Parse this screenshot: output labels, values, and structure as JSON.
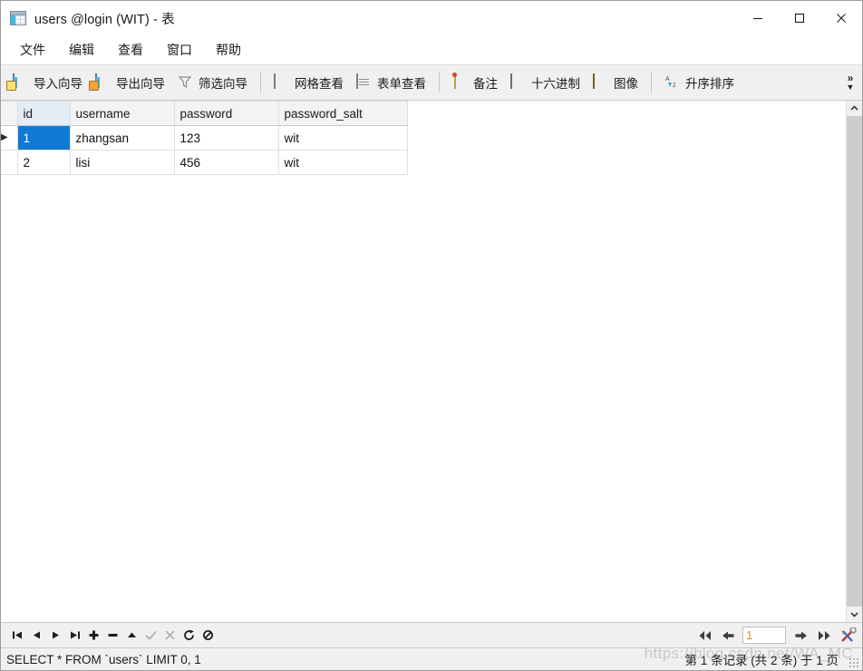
{
  "window": {
    "title": "users @login (WIT) - 表",
    "app_icon": "table-window-icon",
    "controls": {
      "minimize": "minimize-icon",
      "maximize": "maximize-icon",
      "close": "close-icon"
    }
  },
  "menubar": {
    "items": [
      {
        "label": "文件"
      },
      {
        "label": "编辑"
      },
      {
        "label": "查看"
      },
      {
        "label": "窗口"
      },
      {
        "label": "帮助"
      }
    ]
  },
  "toolbar": {
    "groups": [
      {
        "buttons": [
          {
            "label": "导入向导",
            "icon": "import-wizard-icon"
          },
          {
            "label": "导出向导",
            "icon": "export-wizard-icon"
          },
          {
            "label": "筛选向导",
            "icon": "filter-funnel-icon"
          }
        ]
      },
      {
        "buttons": [
          {
            "label": "网格查看",
            "icon": "grid-view-icon"
          },
          {
            "label": "表单查看",
            "icon": "form-view-icon"
          }
        ]
      },
      {
        "buttons": [
          {
            "label": "备注",
            "icon": "note-icon"
          },
          {
            "label": "十六进制",
            "icon": "hex-icon"
          },
          {
            "label": "图像",
            "icon": "image-icon"
          }
        ]
      },
      {
        "buttons": [
          {
            "label": "升序排序",
            "icon": "sort-ascending-icon"
          }
        ]
      }
    ],
    "overflow": {
      "chevron": "»",
      "dropdown": "▼"
    }
  },
  "grid": {
    "columns": [
      {
        "key": "id",
        "label": "id",
        "align": "right",
        "selected": true
      },
      {
        "key": "username",
        "label": "username",
        "align": "left",
        "selected": false
      },
      {
        "key": "password",
        "label": "password",
        "align": "left",
        "selected": false
      },
      {
        "key": "password_salt",
        "label": "password_salt",
        "align": "left",
        "selected": false
      }
    ],
    "rows": [
      {
        "marker": "▶",
        "current": true,
        "cells": {
          "id": "1",
          "username": "zhangsan",
          "password": "123",
          "password_salt": "wit"
        }
      },
      {
        "marker": "",
        "current": false,
        "cells": {
          "id": "2",
          "username": "lisi",
          "password": "456",
          "password_salt": "wit"
        }
      }
    ]
  },
  "scrollbar": {
    "up_icon": "chevron-up-icon",
    "down_icon": "chevron-down-icon"
  },
  "navbar": {
    "buttons": [
      {
        "name": "first-record",
        "icon": "skip-to-start-icon",
        "disabled": false
      },
      {
        "name": "previous-record",
        "icon": "play-back-icon",
        "disabled": false
      },
      {
        "name": "next-record",
        "icon": "play-forward-icon",
        "disabled": false
      },
      {
        "name": "last-record",
        "icon": "skip-to-end-icon",
        "disabled": false
      },
      {
        "name": "add-record",
        "icon": "plus-icon",
        "disabled": false
      },
      {
        "name": "delete-record",
        "icon": "minus-icon",
        "disabled": false
      },
      {
        "name": "apply-record",
        "icon": "triangle-up-icon",
        "disabled": false
      },
      {
        "name": "confirm-edit",
        "icon": "check-icon",
        "disabled": true
      },
      {
        "name": "cancel-edit",
        "icon": "scissors-icon",
        "disabled": true
      },
      {
        "name": "refresh",
        "icon": "refresh-icon",
        "disabled": false
      },
      {
        "name": "stop",
        "icon": "stop-circle-icon",
        "disabled": false
      }
    ],
    "pager": {
      "first_page_icon": "double-arrow-left-icon",
      "prev_page_icon": "arrow-left-icon",
      "page_value": "1",
      "next_page_icon": "arrow-right-icon",
      "last_page_icon": "double-arrow-right-icon",
      "tools_icon": "tools-wrench-icon"
    }
  },
  "statusbar": {
    "sql": "SELECT * FROM `users` LIMIT 0, 1",
    "record_info": "第 1 条记录 (共 2 条) 于 1 页"
  },
  "watermark": {
    "text": "https://blog.csdn.net/WA_MC"
  },
  "colors": {
    "selection_blue": "#0f7ad4",
    "selected_header": "#e4ecf5",
    "toolbar_bg": "#f0f0f0",
    "page_value": "#e08a1e"
  }
}
